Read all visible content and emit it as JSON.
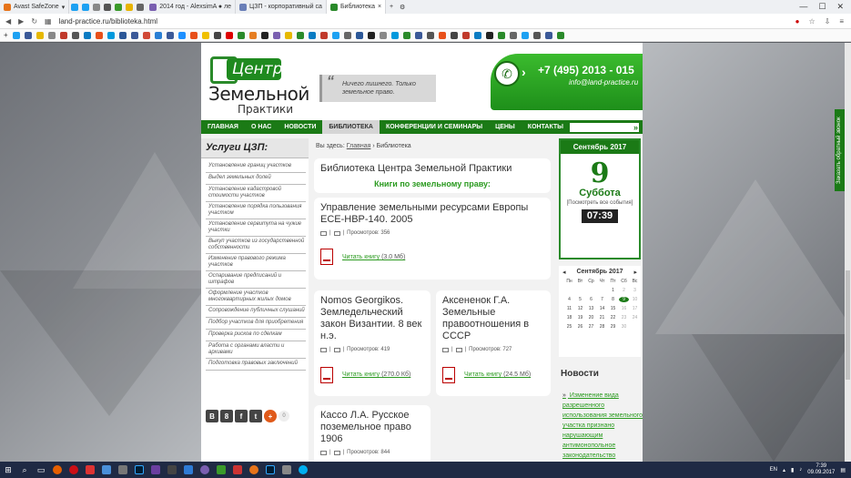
{
  "browser": {
    "tabs": [
      {
        "label": "Avast SafeZone",
        "color": "#e6741b"
      },
      {
        "label": "2014 год - AlexsimA ● ле",
        "color": "#7a5fb0"
      },
      {
        "label": "ЦЗП - корпоративный са",
        "color": "#6a7fb8"
      },
      {
        "label": "Библиотека",
        "color": "#2a8a2a"
      }
    ],
    "url": "land-practice.ru/biblioteka.html"
  },
  "header": {
    "logo_top": "Центр",
    "logo_mid": "Земельной",
    "logo_bottom": "Практики",
    "slogan": "Ничего лишнего. Только земельное право.",
    "phone": "+7 (495) 2013 - 015",
    "email": "info@land-practice.ru"
  },
  "nav": {
    "items": [
      "ГЛАВНАЯ",
      "О НАС",
      "НОВОСТИ",
      "БИБЛИОТЕКА",
      "КОНФЕРЕНЦИИ И СЕМИНАРЫ",
      "ЦЕНЫ",
      "КОНТАКТЫ"
    ],
    "active": 3
  },
  "sidebar": {
    "title": "Услуги ЦЗП:",
    "items": [
      "Установление границ участков",
      "Выдел земельных долей",
      "Установление кадастровой стоимости участков",
      "Установление порядка пользования участком",
      "Установление сервитута на чужие участки",
      "Выкуп участков из государственной собственности",
      "Изменение правового режима участков",
      "Оспаривание предписаний и штрафов",
      "Оформление участков многоквартирных жилых домов",
      "Сопровождение публичных слушаний",
      "Подбор участков для приобретения",
      "Проверка рисков по сделкам",
      "Работа с органами власти и архивами",
      "Подготовка правовых заключений"
    ],
    "social": [
      "В",
      "8",
      "f",
      "t",
      "+"
    ],
    "social_count": "0"
  },
  "breadcrumb": {
    "prefix": "Вы здесь:",
    "home": "Главная",
    "sep": "›",
    "current": "Библиотека"
  },
  "library": {
    "title": "Библиотека Центра Земельной Практики",
    "subtitle": "Книги по земельному праву:"
  },
  "books": [
    {
      "title": "Управление земельными ресурсами Европы ECE-HBP-140. 2005",
      "views": "Просмотров: 356",
      "link": "Читать книгу",
      "size": "(3.0 Мб)"
    },
    {
      "title": "Nomos Georgikos. Земледельческий закон Византии. 8 век н.э.",
      "views": "Просмотров: 419",
      "link": "Читать книгу",
      "size": "(270.0 Кб)"
    },
    {
      "title": "Аксененок Г.А. Земельные правоотношения в СССР",
      "views": "Просмотров: 727",
      "link": "Читать книгу",
      "size": "(24.5 Мб)"
    },
    {
      "title": "Кассо Л.А. Русское поземельное право 1906",
      "views": "Просмотров: 844"
    }
  ],
  "meta_sep": "|",
  "date_widget": {
    "month": "Сентябрь 2017",
    "day": "9",
    "weekday": "Суббота",
    "all_events": "[Посмотреть все события]",
    "time": "07:39"
  },
  "calendar": {
    "month": "Сентябрь 2017",
    "prev": "◂",
    "next": "▸",
    "weekdays": [
      "Пн",
      "Вт",
      "Ср",
      "Чт",
      "Пт",
      "Сб",
      "Вс"
    ],
    "rows": [
      [
        "",
        "",
        "",
        "",
        "1",
        "2",
        "3"
      ],
      [
        "4",
        "5",
        "6",
        "7",
        "8",
        "9",
        "10"
      ],
      [
        "11",
        "12",
        "13",
        "14",
        "15",
        "16",
        "17"
      ],
      [
        "18",
        "19",
        "20",
        "21",
        "22",
        "23",
        "24"
      ],
      [
        "25",
        "26",
        "27",
        "28",
        "29",
        "30",
        ""
      ]
    ],
    "today": "9"
  },
  "news": {
    "title": "Новости",
    "bullet": "»",
    "item": "Изменение вида разрешенного использования земельного участка признано нарушающим антимонопольное законодательство"
  },
  "side_tab": "Заказать обратный звонок",
  "taskbar": {
    "lang": "EN",
    "time": "7:39",
    "date": "09.09.2017"
  }
}
